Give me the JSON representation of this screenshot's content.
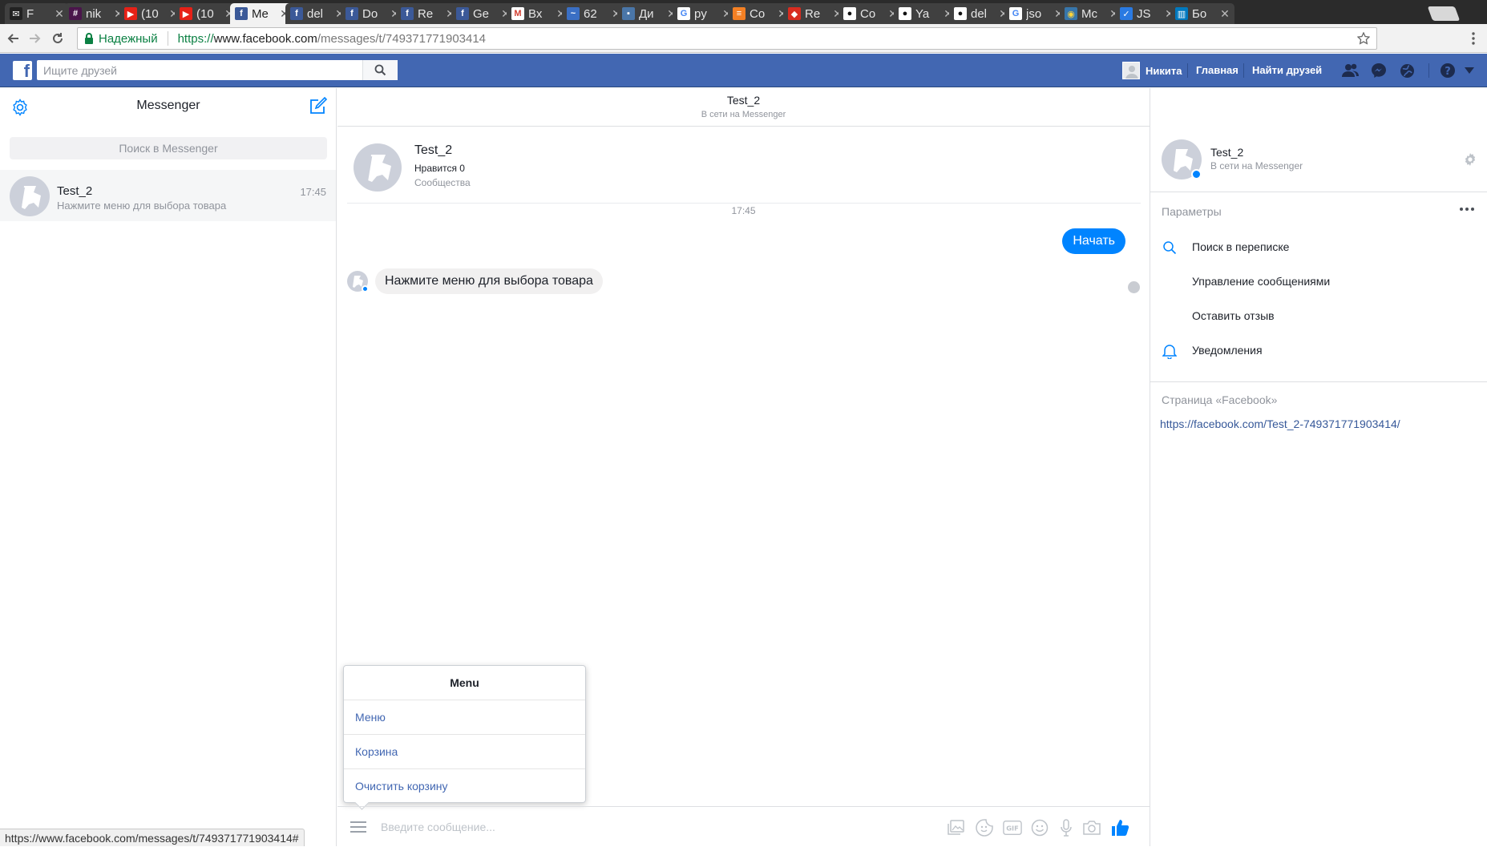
{
  "browser": {
    "tabs": [
      {
        "title": "F",
        "favicon": "mail-icon",
        "color": "#222222"
      },
      {
        "title": "nik",
        "favicon": "slack-icon",
        "color": "#4a154b"
      },
      {
        "title": "(10",
        "favicon": "youtube-icon",
        "color": "#e62117"
      },
      {
        "title": "(10",
        "favicon": "youtube-icon",
        "color": "#e62117"
      },
      {
        "title": "Me",
        "favicon": "facebook-icon",
        "color": "#3b5998",
        "active": true
      },
      {
        "title": "del",
        "favicon": "facebook-icon",
        "color": "#3b5998"
      },
      {
        "title": "Do",
        "favicon": "facebook-icon",
        "color": "#3b5998"
      },
      {
        "title": "Re",
        "favicon": "facebook-icon",
        "color": "#3b5998"
      },
      {
        "title": "Ge",
        "favicon": "facebook-icon",
        "color": "#3b5998"
      },
      {
        "title": "Вх",
        "favicon": "gmail-icon",
        "color": "#d23f31"
      },
      {
        "title": "62",
        "favicon": "ticket-icon",
        "color": "#3a6fc4"
      },
      {
        "title": "Ди",
        "favicon": "chat-icon",
        "color": "#4a76a8"
      },
      {
        "title": "py",
        "favicon": "google-icon",
        "color": "#4285f4"
      },
      {
        "title": "Co",
        "favicon": "stackoverflow-icon",
        "color": "#f48024"
      },
      {
        "title": "Re",
        "favicon": "redis-icon",
        "color": "#d82c20"
      },
      {
        "title": "Co",
        "favicon": "github-icon",
        "color": "#111111"
      },
      {
        "title": "Ya",
        "favicon": "github-icon",
        "color": "#111111"
      },
      {
        "title": "del",
        "favicon": "github-icon",
        "color": "#111111"
      },
      {
        "title": "jso",
        "favicon": "google-icon",
        "color": "#4285f4"
      },
      {
        "title": "Mc",
        "favicon": "python-icon",
        "color": "#3776ab"
      },
      {
        "title": "JS",
        "favicon": "checkbox-icon",
        "color": "#2a7ae2"
      },
      {
        "title": "Бо",
        "favicon": "trello-icon",
        "color": "#0079bf"
      }
    ],
    "secure_label": "Надежный",
    "url_scheme": "https://",
    "url_host": "www.facebook.com",
    "url_path": "/messages/t/749371771903414",
    "status_url": "https://www.facebook.com/messages/t/749371771903414#"
  },
  "fb": {
    "search_placeholder": "Ищите друзей",
    "user_name": "Никита",
    "home_label": "Главная",
    "find_friends_label": "Найти друзей",
    "brand_color": "#4267b2"
  },
  "left": {
    "title": "Messenger",
    "search_placeholder": "Поиск в Messenger",
    "conversation": {
      "name": "Test_2",
      "time": "17:45",
      "snippet": "Нажмите меню для выбора товара"
    }
  },
  "chat": {
    "title": "Test_2",
    "status": "В сети на Messenger",
    "page_name": "Test_2",
    "page_likes": "Нравится 0",
    "page_category": "Сообщества",
    "timestamp": "17:45",
    "outgoing_message": "Начать",
    "incoming_message": "Нажмите меню для выбора товара",
    "accent_color": "#0084ff",
    "menu": {
      "title": "Menu",
      "items": [
        "Меню",
        "Корзина",
        "Очистить корзину"
      ]
    },
    "composer_placeholder": "Введите сообщение..."
  },
  "right": {
    "name": "Test_2",
    "status": "В сети на Messenger",
    "params_label": "Параметры",
    "actions": [
      {
        "label": "Поиск в переписке",
        "icon": "search-icon"
      },
      {
        "label": "Управление сообщениями",
        "icon": ""
      },
      {
        "label": "Оставить отзыв",
        "icon": ""
      },
      {
        "label": "Уведомления",
        "icon": "bell-icon"
      }
    ],
    "page_section_label": "Страница «Facebook»",
    "page_link": "https://facebook.com/Test_2-749371771903414/"
  }
}
